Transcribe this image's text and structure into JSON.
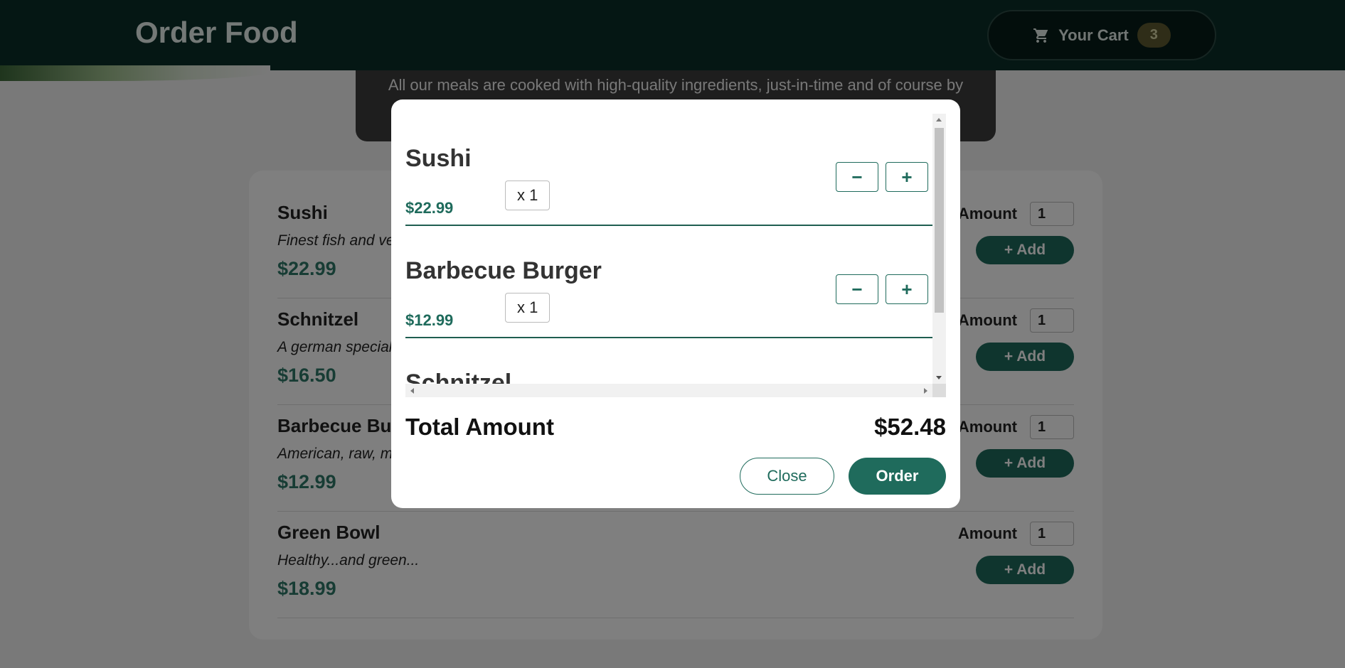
{
  "header": {
    "title": "Order Food",
    "cart": {
      "label": "Your Cart",
      "count": "3",
      "icon": "cart-icon"
    }
  },
  "summary": {
    "text": "All our meals are cooked with high-quality ingredients, just-in-time and of course by"
  },
  "meals": [
    {
      "name": "Sushi",
      "description": "Finest fish and ve",
      "price": "$22.99",
      "amount_label": "Amount",
      "amount": "1",
      "add_label": "+ Add"
    },
    {
      "name": "Schnitzel",
      "description": "A german special",
      "price": "$16.50",
      "amount_label": "Amount",
      "amount": "1",
      "add_label": "+ Add"
    },
    {
      "name": "Barbecue Burg",
      "description": "American, raw, m",
      "price": "$12.99",
      "amount_label": "Amount",
      "amount": "1",
      "add_label": "+ Add"
    },
    {
      "name": "Green Bowl",
      "description": "Healthy...and green...",
      "price": "$18.99",
      "amount_label": "Amount",
      "amount": "1",
      "add_label": "+ Add"
    }
  ],
  "modal": {
    "items": [
      {
        "name": "Sushi",
        "price": "$22.99",
        "quantity": "x 1",
        "decrement": "−",
        "increment": "+"
      },
      {
        "name": "Barbecue Burger",
        "price": "$12.99",
        "quantity": "x 1",
        "decrement": "−",
        "increment": "+"
      },
      {
        "name": "Schnitzel",
        "price": "",
        "quantity": "",
        "decrement": "−",
        "increment": "+"
      }
    ],
    "total_label": "Total Amount",
    "total_value": "$52.48",
    "close_label": "Close",
    "order_label": "Order"
  },
  "colors": {
    "header": "#0b2e28",
    "accent": "#1f6b5c",
    "price": "#2f7868"
  }
}
